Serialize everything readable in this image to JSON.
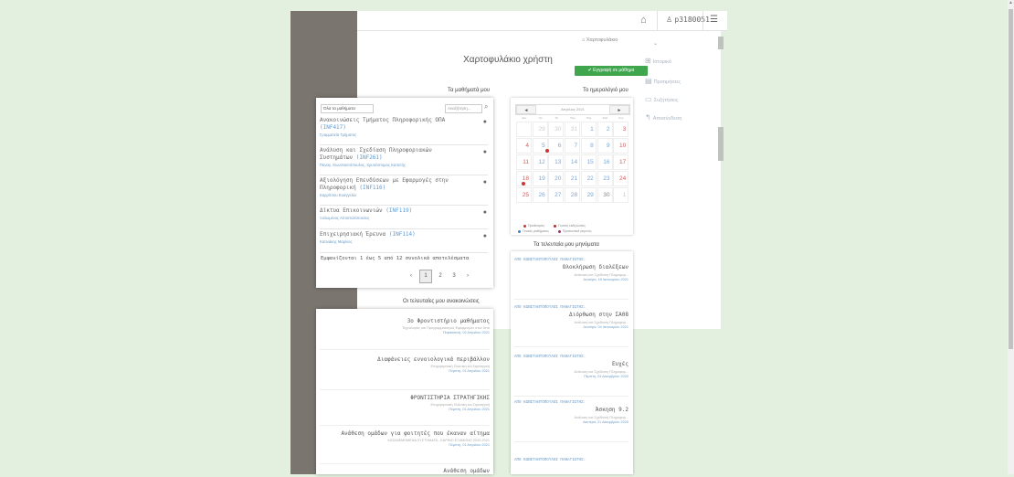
{
  "topbar": {
    "user": "p3180051"
  },
  "breadcrumb": "Χαρτοφυλάκιο",
  "page_title": "Χαρτοφυλάκιο χρήστη",
  "enroll_button": "✔ Εγγραφή σε μάθημα",
  "sections": {
    "my_courses": "Τα μαθήματά μου",
    "my_calendar": "Το ημερολόγιό μου",
    "my_announcements": "Οι τελευταίες μου ανακοινώσεις",
    "my_posts": "Τα τελευταία μου μηνύματα"
  },
  "right_nav": [
    "Ιστορικό",
    "Προτιμήσεις",
    "Συζητήσεις",
    "Αποσύνδεση"
  ],
  "courses_panel": {
    "select_label": "Όλα τα μαθήματα",
    "search_placeholder": "Αναζήτηση...",
    "courses": [
      {
        "title": "Ανακοινώσεις Τμήματος Πληροφορικής ΟΠΑ",
        "code": "(INF417)",
        "teacher": "Γραμματεία Τμήματος"
      },
      {
        "title": "Ανάλυση και Σχεδίαση Πληροφοριακών Συστημάτων",
        "code": "(INF261)",
        "teacher": "Παναγ. Κωνσταντόπουλος, Χρυσόστομος Καπετής"
      },
      {
        "title": "Αξιολόγηση Επενδύσεων με Εφαρμογές στην Πληροφορική",
        "code": "(INF116)",
        "teacher": "Καρρίτσου Ευαγγελία"
      },
      {
        "title": "Δίκτυα Επικοινωνιών",
        "code": "(INF119)",
        "teacher": "Ξυλωμένος Αποστολόπουλος"
      },
      {
        "title": "Επιχειρησιακή Έρευνα",
        "code": "(INF114)",
        "teacher": "Κατινάκης Μαρίνος"
      }
    ],
    "results_text": "Εμφανίζονται 1 έως 5 από 12 συνολικά αποτελέσματα",
    "pagination": [
      "‹",
      "1",
      "2",
      "3",
      "›"
    ]
  },
  "calendar": {
    "month_label": "Απρίλιος 2021",
    "prev": "◄",
    "next": "►",
    "days_of_week": [
      "Δευ",
      "Τρι",
      "Τετ",
      "Πεμ",
      "Παρ",
      "Σαβ",
      "Κυρ"
    ],
    "weeks": [
      [
        "29",
        "30",
        "31",
        "1",
        "2",
        "3"
      ],
      [
        "4",
        "5",
        "6",
        "7",
        "8",
        "9",
        "10"
      ],
      [
        "11",
        "12",
        "13",
        "14",
        "15",
        "16",
        "17"
      ],
      [
        "18",
        "19",
        "20",
        "21",
        "22",
        "23",
        "24"
      ],
      [
        "25",
        "26",
        "27",
        "28",
        "29",
        "30",
        "1"
      ]
    ],
    "legend": [
      "Προθεσμίες",
      "Γενικές εκδηλώσεις",
      "Γενικές μαθήματος",
      "Προσωπικά γεγονός"
    ]
  },
  "announcements": [
    {
      "title": "3ο Φροντιστήριο μαθήματος",
      "course": "Τεχνολογίες και Προγραμματισμός Εφαρμογών στον Ιστό",
      "date": "Παρασκευή, 02 Απριλίου 2021"
    },
    {
      "title": "Διαφάνειες εννοιολογικά περιβάλλον",
      "course": "Επιχειρησιακή Πολιτική και Στρατηγική",
      "date": "Πέμπτη, 01 Απριλίου 2021"
    },
    {
      "title": "ΦΡΟΝΤΙΣΤΗΡΙΑ ΣΤΡΑΤΗΓΙΚΗΣ",
      "course": "Επιχειρησιακή Πολιτική και Στρατηγική",
      "date": "Πέμπτη, 01 Απριλίου 2021"
    },
    {
      "title": "Ανάθεση ομάδων για φοιτητές που έκαναν αίτημα",
      "course": "ΚΑΤΑΝΕΜΗΜΕΝΑ ΣΥΣΤΗΜΑΤΑ - ΕΑΡΙΝΟ ΕΞΑΜΗΝΟ 2020-2021",
      "date": "Πέμπτη, 01 Απριλίου 2021"
    },
    {
      "title": "Ανάθεση ομάδων",
      "course": "",
      "date": ""
    }
  ],
  "posts": [
    {
      "from": "ΑΠΟ ΚΩΝΣΤΑΝΤΟΠΟΥΛΟΣ ΠΑΝΑΓΙΩΤΗΣ:",
      "title": "Ολοκλήρωση διαλέξεων",
      "course": "Ανάλυση και Σχεδίαση Πληροφορ...",
      "date": "Δευτέρα, 18 Ιανουαρίου 2021"
    },
    {
      "from": "ΑΠΟ ΚΩΝΣΤΑΝΤΟΠΟΥΛΟΣ ΠΑΝΑΓΙΩΤΗΣ:",
      "title": "Διόρθωση στην ΣΑ08",
      "course": "Ανάλυση και Σχεδίαση Πληροφορ...",
      "date": "Δευτέρα, 04 Ιανουαρίου 2021"
    },
    {
      "from": "ΑΠΟ ΚΩΝΣΤΑΝΤΟΠΟΥΛΟΣ ΠΑΝΑΓΙΩΤΗΣ:",
      "title": "Ευχές",
      "course": "Ανάλυση και Σχεδίαση Πληροφορ...",
      "date": "Πέμπτη, 24 Δεκεμβρίου 2020"
    },
    {
      "from": "ΑΠΟ ΚΩΝΣΤΑΝΤΟΠΟΥΛΟΣ ΠΑΝΑΓΙΩΤΗΣ:",
      "title": "Άσκηση 9.2",
      "course": "Ανάλυση και Σχεδίαση Πληροφορ...",
      "date": "Δευτέρα, 21 Δεκεμβρίου 2020"
    },
    {
      "from": "ΑΠΟ ΚΩΝΣΤΑΝΤΟΠΟΥΛΟΣ ΠΑΝΑΓΙΩΤΗΣ:",
      "title": "",
      "course": "",
      "date": ""
    }
  ]
}
